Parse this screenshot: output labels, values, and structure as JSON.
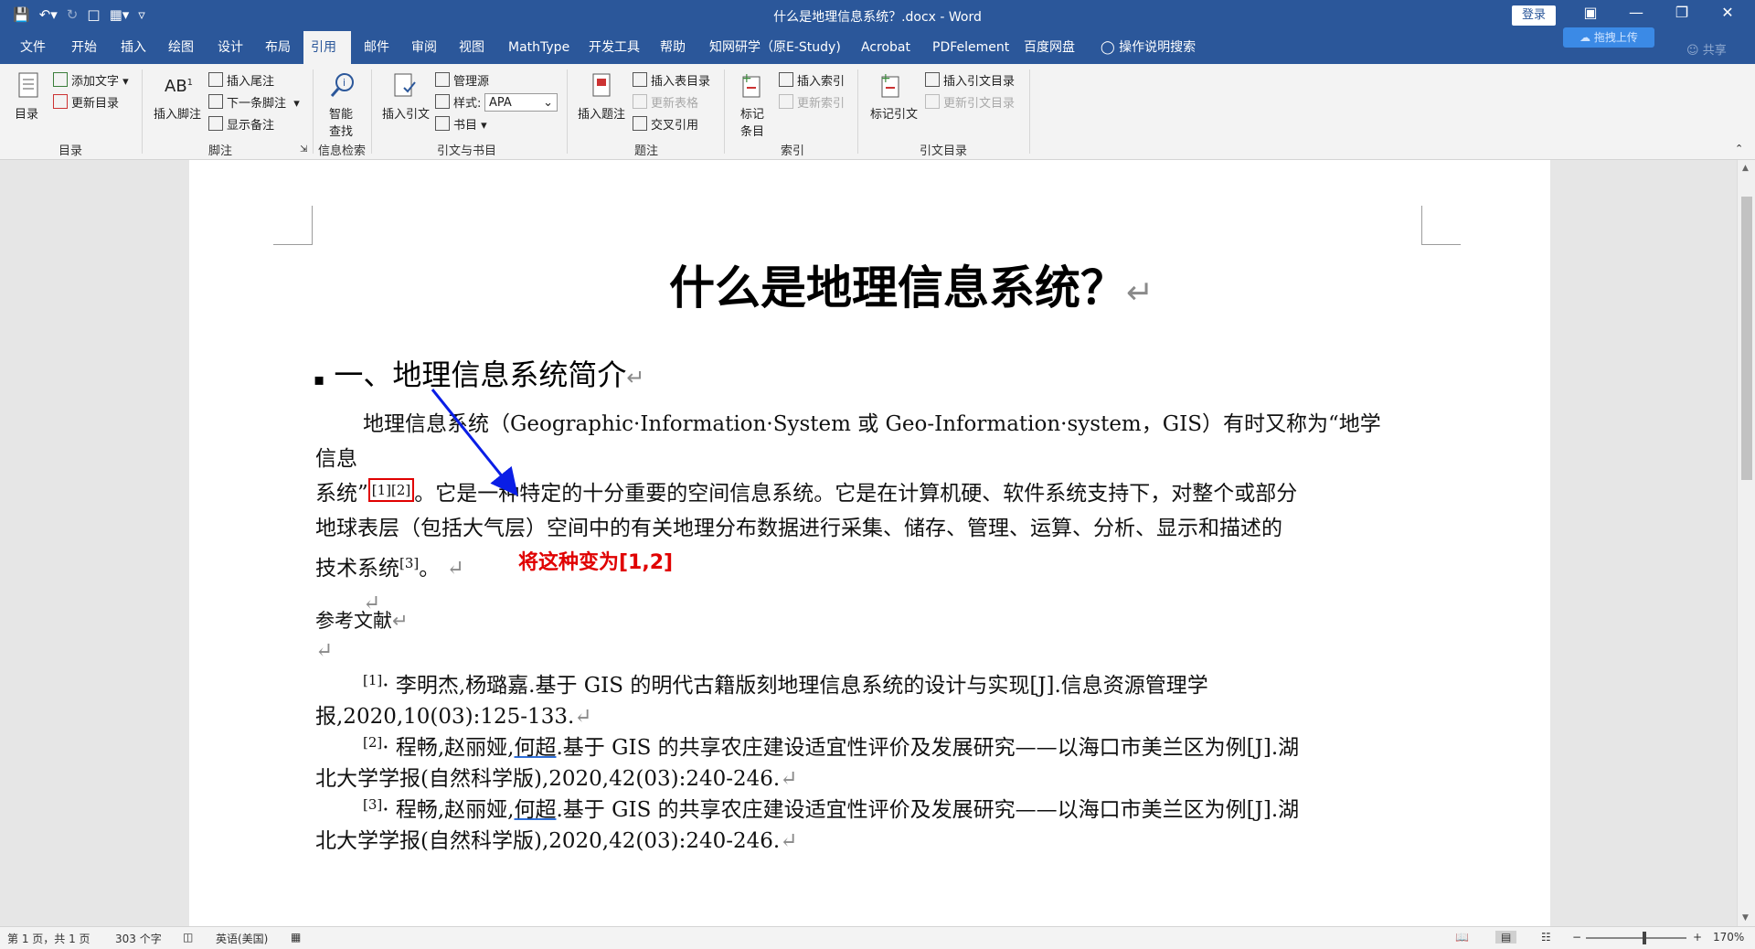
{
  "titlebar": {
    "title": "什么是地理信息系统？.docx  -  Word",
    "login_label": "登录",
    "icons": [
      "save-icon",
      "undo-icon",
      "redo-icon",
      "new-doc-icon",
      "layout-icon",
      "customize-qat-icon"
    ]
  },
  "tabs": [
    "文件",
    "开始",
    "插入",
    "绘图",
    "设计",
    "布局",
    "引用",
    "邮件",
    "审阅",
    "视图",
    "MathType",
    "开发工具",
    "帮助",
    "知网研学（原E-Study)",
    "Acrobat",
    "PDFelement",
    "百度网盘"
  ],
  "active_tab": "引用",
  "tellme": "操作说明搜索",
  "upload_label": "拖拽上传",
  "share_label": "共享",
  "ribbon": {
    "toc": {
      "big": "目录",
      "add_text": "添加文字",
      "update": "更新目录",
      "group": "目录"
    },
    "footnote": {
      "insert_footnote": "插入脚注",
      "insert_endnote": "插入尾注",
      "next_footnote": "下一条脚注",
      "show_notes": "显示备注",
      "group": "脚注"
    },
    "research": {
      "smart_lookup_1": "智能",
      "smart_lookup_2": "查找",
      "group": "信息检索"
    },
    "citations": {
      "insert_citation": "插入引文",
      "manage_sources": "管理源",
      "style_label": "样式:",
      "style_value": "APA",
      "bibliography": "书目",
      "group": "引文与书目"
    },
    "captions": {
      "insert_caption": "插入题注",
      "insert_table_of_figures": "插入表目录",
      "update_table": "更新表格",
      "cross_reference": "交叉引用",
      "group": "题注"
    },
    "index": {
      "mark_entry_1": "标记",
      "mark_entry_2": "条目",
      "insert_index": "插入索引",
      "update_index": "更新索引",
      "group": "索引"
    },
    "toa": {
      "mark_citation": "标记引文",
      "insert_toa": "插入引文目录",
      "update_toa": "更新引文目录",
      "group": "引文目录"
    }
  },
  "document": {
    "title": "什么是地理信息系统？",
    "heading": "一、地理信息系统简介",
    "para_line1": "地理信息系统（Geographic·Information·System 或 Geo-Information·system，GIS）有时又称为“地学信息",
    "para_line2_a": "系统”",
    "cite_12": "[1][2]",
    "para_line2_b": "。它是一种特定的十分重要的空间信息系统。它是在计算机硬、软件系统支持下，对整个或部分",
    "para_line3": "地球表层（包括大气层）空间中的有关地理分布数据进行采集、储存、管理、运算、分析、显示和描述的",
    "para_line4": "技术系统",
    "cite_3": "[3]",
    "para_line4_end": "。",
    "annotation": "将这种变为[1,2]",
    "refs_title": "参考文献",
    "refs": [
      {
        "num": "[1]",
        "line1": "· 李明杰,杨璐嘉.基于 GIS 的明代古籍版刻地理信息系统的设计与实现[J].信息资源管理学",
        "line2": "报,2020,10(03):125-133."
      },
      {
        "num": "[2]",
        "line1_a": "· 程畅,赵丽娅,",
        "author_ul": "何超",
        "line1_b": ".基于 GIS 的共享农庄建设适宜性评价及发展研究——以海口市美兰区为例[J].湖",
        "line2": "北大学学报(自然科学版),2020,42(03):240-246."
      },
      {
        "num": "[3]",
        "line1_a": "· 程畅,赵丽娅,",
        "author_ul": "何超",
        "line1_b": ".基于 GIS 的共享农庄建设适宜性评价及发展研究——以海口市美兰区为例[J].湖",
        "line2": "北大学学报(自然科学版),2020,42(03):240-246."
      }
    ],
    "para_mark": "↵"
  },
  "statusbar": {
    "page": "第 1 页，共 1 页",
    "words": "303 个字",
    "language": "英语(美国)",
    "zoom": "170%",
    "zoom_minus": "−",
    "zoom_plus": "+"
  },
  "colors": {
    "titlebar": "#2b579a",
    "annotation": "#e00000",
    "arrow": "#0a1ee6"
  }
}
